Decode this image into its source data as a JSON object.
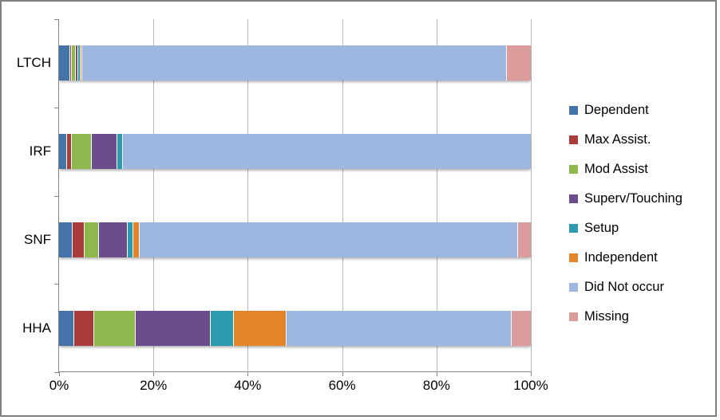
{
  "chart_data": {
    "type": "bar",
    "subtype": "stacked-horizontal-100-percent",
    "title": "",
    "xlabel": "",
    "ylabel": "",
    "categories": [
      "LTCH",
      "IRF",
      "SNF",
      "HHA"
    ],
    "xticks": [
      "0%",
      "20%",
      "40%",
      "60%",
      "80%",
      "100%"
    ],
    "xtick_values": [
      0,
      20,
      40,
      60,
      80,
      100
    ],
    "xlim": [
      0,
      100
    ],
    "grid": true,
    "legend_position": "right",
    "series": [
      {
        "name": "Dependent",
        "color": "#4473A7",
        "values": [
          2.4,
          1.7,
          2.9,
          3.2
        ]
      },
      {
        "name": "Max Assist.",
        "color": "#A93B3B",
        "values": [
          0.3,
          1.0,
          2.6,
          4.2
        ]
      },
      {
        "name": "Mod Assist",
        "color": "#8FB84E",
        "values": [
          0.9,
          4.2,
          2.9,
          8.8
        ]
      },
      {
        "name": "Superv/Touching",
        "color": "#6B4C8D",
        "values": [
          0.4,
          5.4,
          6.1,
          15.9
        ]
      },
      {
        "name": "Setup",
        "color": "#2E9AB0",
        "values": [
          0.5,
          1.2,
          1.2,
          4.9
        ]
      },
      {
        "name": "Independent",
        "color": "#E3862B",
        "values": [
          0.4,
          0.0,
          1.4,
          11.2
        ]
      },
      {
        "name": "Did Not occur",
        "color": "#9DB7E0",
        "values": [
          90.1,
          86.5,
          80.2,
          47.8
        ]
      },
      {
        "name": "Missing",
        "color": "#DC9C9C",
        "values": [
          5.0,
          0.0,
          2.7,
          4.0
        ]
      }
    ]
  }
}
